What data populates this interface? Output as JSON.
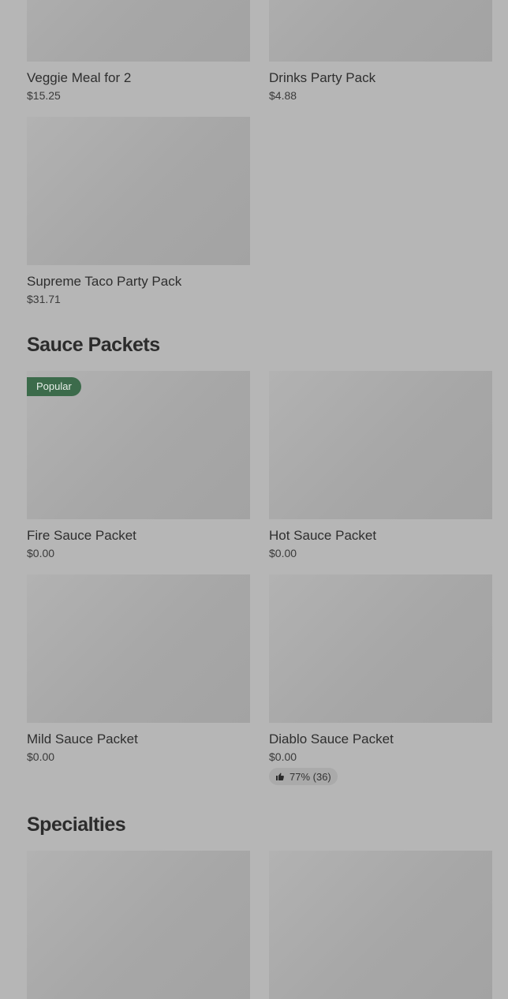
{
  "top_items": [
    {
      "name": "Veggie Meal for 2",
      "price": "$15.25"
    },
    {
      "name": "Drinks Party Pack",
      "price": "$4.88"
    },
    {
      "name": "Supreme Taco Party Pack",
      "price": "$31.71"
    }
  ],
  "sauce_section": {
    "title": "Sauce Packets",
    "items": [
      {
        "name": "Fire Sauce Packet",
        "price": "$0.00",
        "badge": "Popular"
      },
      {
        "name": "Hot Sauce Packet",
        "price": "$0.00"
      },
      {
        "name": "Mild Sauce Packet",
        "price": "$0.00"
      },
      {
        "name": "Diablo Sauce Packet",
        "price": "$0.00",
        "rating": "77% (36)",
        "rating_icon": "thumbs-up-icon"
      }
    ]
  },
  "specialties_section": {
    "title": "Specialties"
  },
  "colors": {
    "background": "#b6b6b6",
    "badge_bg": "#3c6b4b",
    "image_placeholder": "#a7a7a7"
  }
}
